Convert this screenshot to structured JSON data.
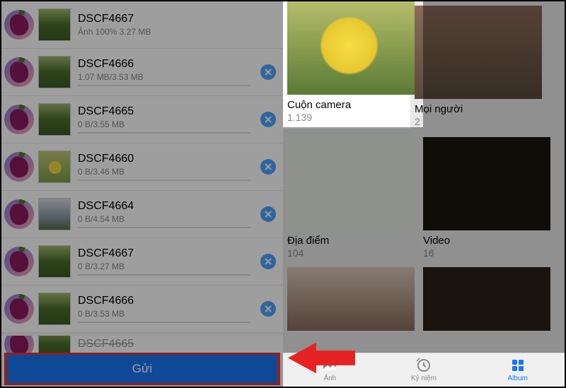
{
  "files": [
    {
      "name": "DSCF4667",
      "status": "Ảnh 100% 3.27 MB",
      "cancel": false,
      "thumb": "greenery"
    },
    {
      "name": "DSCF4666",
      "status": "1.07 MB/3.53 MB",
      "cancel": true,
      "thumb": "greenery"
    },
    {
      "name": "DSCF4665",
      "status": "0 B/3.55 MB",
      "cancel": true,
      "thumb": "greenery"
    },
    {
      "name": "DSCF4660",
      "status": "0 B/3.46 MB",
      "cancel": true,
      "thumb": "flower"
    },
    {
      "name": "DSCF4664",
      "status": "0 B/4.54 MB",
      "cancel": true,
      "thumb": "building"
    },
    {
      "name": "DSCF4667",
      "status": "0 B/3.27 MB",
      "cancel": true,
      "thumb": "greenery"
    },
    {
      "name": "DSCF4666",
      "status": "0 B/3.53 MB",
      "cancel": true,
      "thumb": "greenery"
    }
  ],
  "partial_file_name": "DSCF4665",
  "send_button": "Gửi",
  "albums": [
    {
      "title": "Cuộn camera",
      "count": "1.139",
      "thumb": "flower-big",
      "highlight": true
    },
    {
      "title": "Mọi người",
      "count": "2",
      "thumb": "people",
      "highlight": false
    },
    {
      "title": "Địa điểm",
      "count": "104",
      "thumb": "map",
      "highlight": false
    },
    {
      "title": "Video",
      "count": "16",
      "thumb": "video",
      "highlight": false
    }
  ],
  "extra_albums": [
    {
      "thumb": "selfie"
    },
    {
      "thumb": "dark"
    }
  ],
  "tabs": [
    {
      "label": "Ảnh",
      "icon": "photo",
      "active": false
    },
    {
      "label": "Kỷ niệm",
      "icon": "memories",
      "active": false
    },
    {
      "label": "Album",
      "icon": "album",
      "active": true
    }
  ]
}
